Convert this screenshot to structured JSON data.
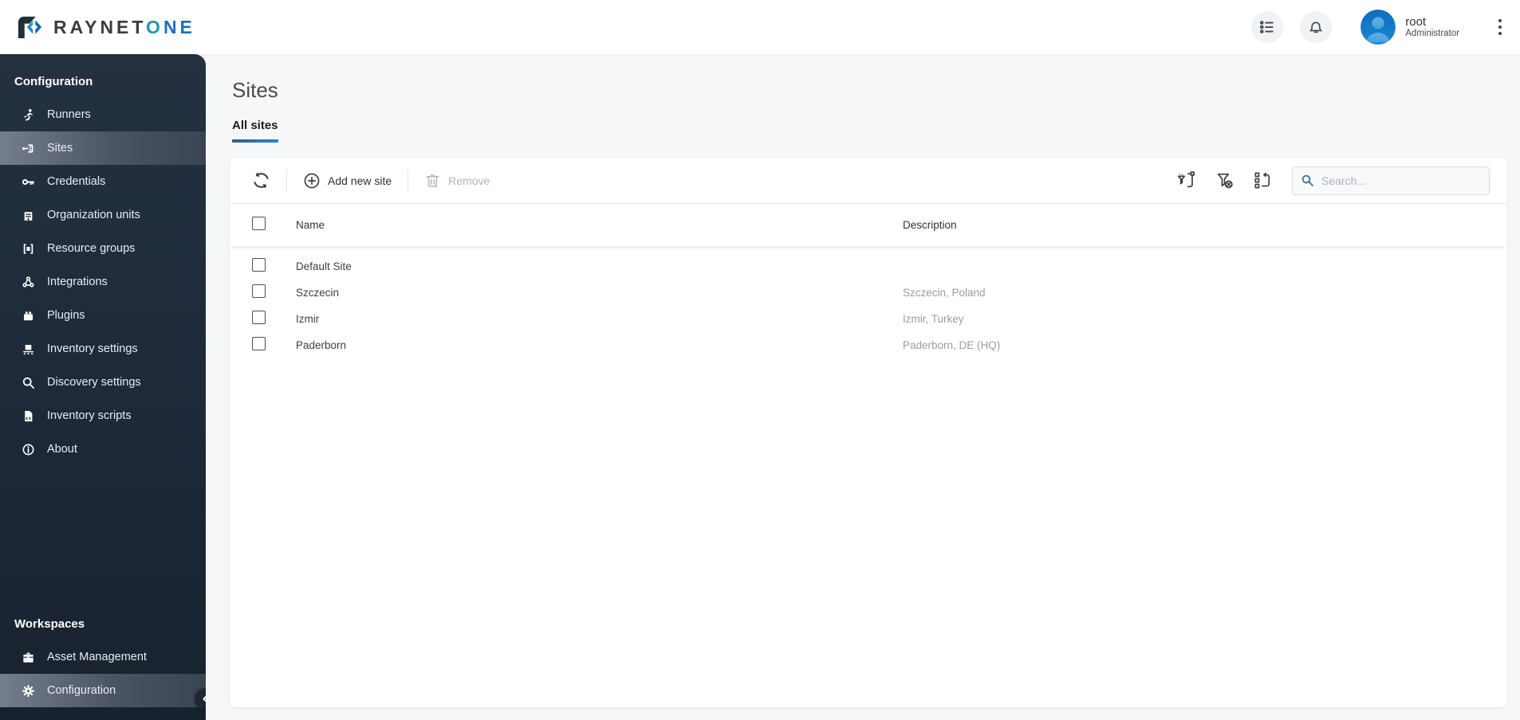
{
  "brand": {
    "dark_part": "RAYNET",
    "accent_o": "O",
    "accent_ne": "NE"
  },
  "topbar": {
    "icons": [
      "view-options-icon",
      "notifications-bell-icon",
      "more-options-kebab-icon"
    ],
    "user": {
      "name": "root",
      "role": "Administrator",
      "avatar_icon": "user-avatar-icon"
    }
  },
  "sidebar": {
    "config_header": "Configuration",
    "config_items": [
      {
        "label": "Runners",
        "icon": "runner-icon",
        "selected": false
      },
      {
        "label": "Sites",
        "icon": "sites-network-icon",
        "selected": true
      },
      {
        "label": "Credentials",
        "icon": "key-icon",
        "selected": false
      },
      {
        "label": "Organization units",
        "icon": "building-icon",
        "selected": false
      },
      {
        "label": "Resource groups",
        "icon": "resource-group-icon",
        "selected": false
      },
      {
        "label": "Integrations",
        "icon": "integrations-links-icon",
        "selected": false
      },
      {
        "label": "Plugins",
        "icon": "plugin-brick-icon",
        "selected": false
      },
      {
        "label": "Inventory settings",
        "icon": "conveyor-box-icon",
        "selected": false
      },
      {
        "label": "Discovery settings",
        "icon": "magnifier-icon",
        "selected": false
      },
      {
        "label": "Inventory scripts",
        "icon": "script-document-icon",
        "selected": false
      },
      {
        "label": "About",
        "icon": "info-circle-icon",
        "selected": false
      }
    ],
    "workspaces_header": "Workspaces",
    "workspace_items": [
      {
        "label": "Asset Management",
        "icon": "toolbox-icon",
        "selected": false
      },
      {
        "label": "Configuration",
        "icon": "gear-icon",
        "selected": true
      }
    ],
    "collapse_icon": "chevron-left-icon"
  },
  "page": {
    "title": "Sites",
    "tabs": [
      {
        "label": "All sites",
        "active": true
      }
    ]
  },
  "toolbar": {
    "refresh_icon": "refresh-icon",
    "add_label": "Add new site",
    "add_icon": "plus-circle-icon",
    "remove_label": "Remove",
    "remove_icon": "trash-icon",
    "remove_enabled": false,
    "right_icons": [
      "filter-add-icon",
      "clear-filter-icon",
      "choose-columns-icon"
    ],
    "search_placeholder": "Search...",
    "search_value": ""
  },
  "table": {
    "columns": {
      "name": "Name",
      "description": "Description"
    },
    "rows": [
      {
        "name": "Default Site",
        "description": ""
      },
      {
        "name": "Szczecin",
        "description": "Szczecin, Poland"
      },
      {
        "name": "Izmir",
        "description": "Izmir, Turkey"
      },
      {
        "name": "Paderborn",
        "description": "Paderborn, DE (HQ)"
      }
    ]
  },
  "colors": {
    "sidebar_bg": "#1d2938",
    "selected_item_gradient_left": "#747e8c",
    "selected_item_gradient_right": "#3a4452",
    "tab_underline_left": "#3d5a7a",
    "tab_underline_right": "#1b8ccc",
    "avatar_blue": "#1178c8",
    "brand_teal": "#2496ae",
    "brand_blue": "#1a6fc0",
    "content_bg": "#f6f7f8",
    "description_text": "#9c9ca0"
  }
}
